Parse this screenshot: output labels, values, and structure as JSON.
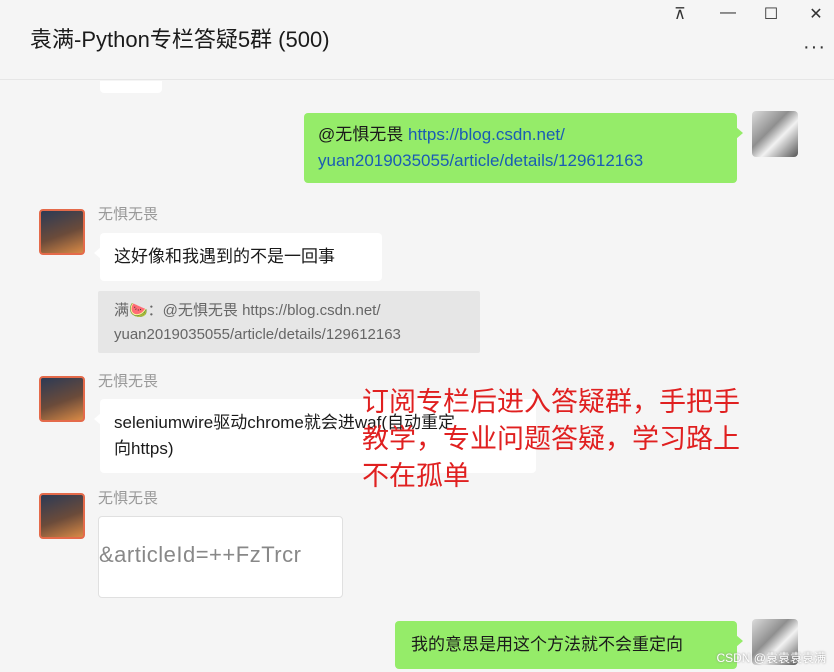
{
  "window": {
    "title": "袁满-Python专栏答疑5群 (500)",
    "controls": {
      "pin": "⊼",
      "minimize": "—",
      "maximize": "☐",
      "close": "✕"
    },
    "more": "···"
  },
  "messages": [
    {
      "kind": "outgoing",
      "mention": "@无惧无畏",
      "link_line1": "https://blog.csdn.net/",
      "link_line2": "yuan2019035055/article/details/129612163"
    },
    {
      "kind": "incoming",
      "sender": "无惧无畏",
      "text": "这好像和我遇到的不是一回事",
      "quote_line1": "满🍉：@无惧无畏 https://blog.csdn.net/",
      "quote_line2": "yuan2019035055/article/details/129612163"
    },
    {
      "kind": "incoming",
      "sender": "无惧无畏",
      "text_line1": "seleniumwire驱动chrome就会进waf(自动重定",
      "text_line2": "向https)"
    },
    {
      "kind": "incoming",
      "sender": "无惧无畏",
      "card_text": "&articleId=++FzTrcr"
    },
    {
      "kind": "outgoing",
      "text": "我的意思是用这个方法就不会重定向"
    }
  ],
  "promo": {
    "line1": "订阅专栏后进入答疑群，手把手",
    "line2": "教学，专业问题答疑，学习路上",
    "line3": "不在孤单"
  },
  "watermark": "CSDN @袁袁袁袁满",
  "colors": {
    "outgoing_bubble": "#95ec69",
    "incoming_bubble": "#ffffff",
    "link": "#1a5cb4",
    "promo_text": "#e02020",
    "background": "#f5f5f5"
  }
}
